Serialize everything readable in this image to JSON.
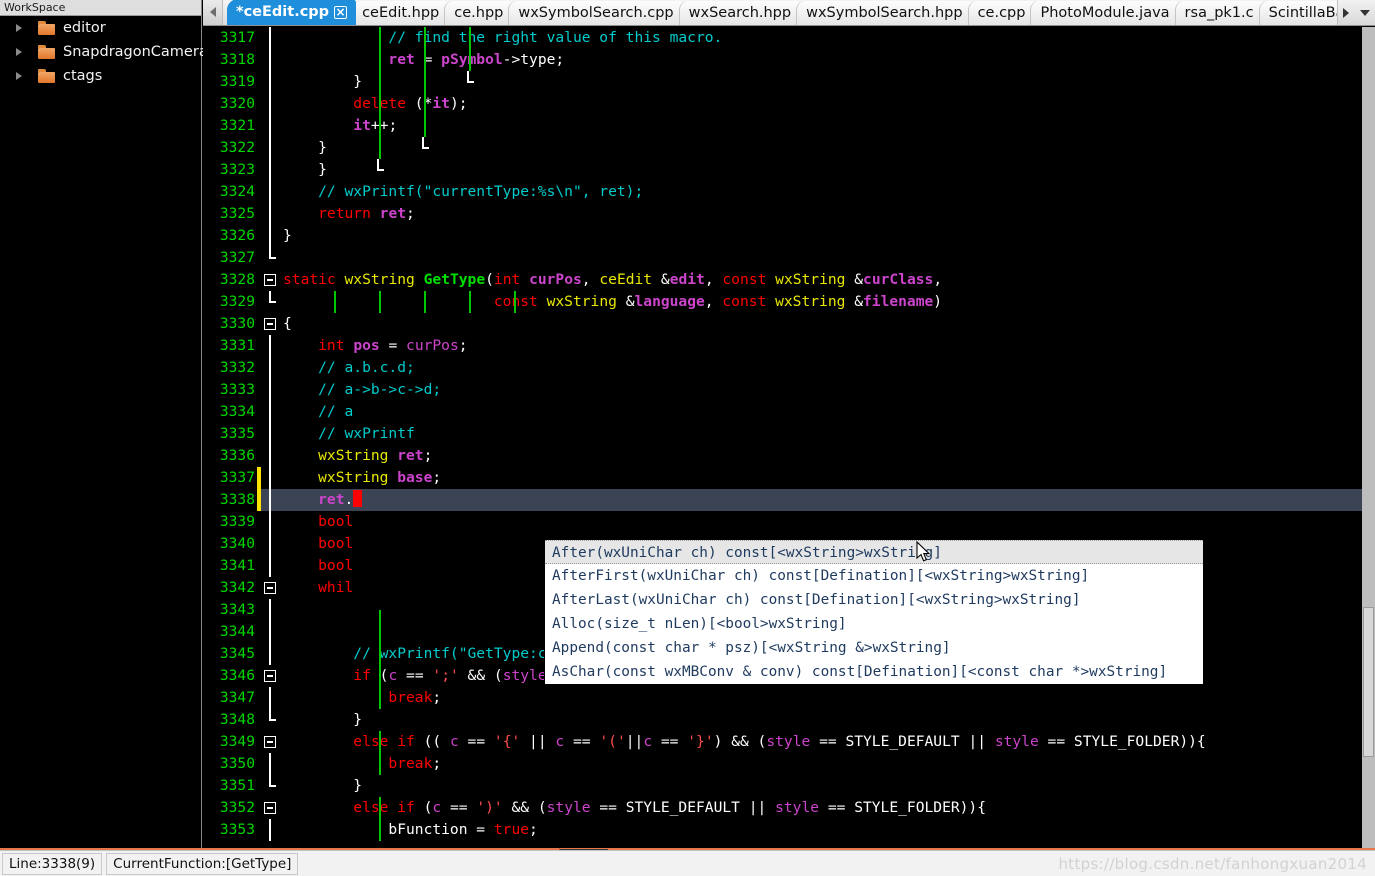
{
  "sidebar": {
    "header": "WorkSpace",
    "items": [
      {
        "label": "editor",
        "icon": "folder-icon",
        "expander": "triangle-right-icon"
      },
      {
        "label": "SnapdragonCamera",
        "icon": "folder-icon",
        "expander": "triangle-right-icon"
      },
      {
        "label": "ctags",
        "icon": "folder-icon",
        "expander": "triangle-right-icon"
      }
    ]
  },
  "tabbar": {
    "scroll_left_icon": "triangle-left-icon",
    "overflow_next_icon": "triangle-right-icon",
    "overflow_menu_icon": "chevron-down-icon",
    "close_glyph": "✖",
    "tabs": [
      {
        "label": "*ceEdit.cpp",
        "active": true,
        "closable": true
      },
      {
        "label": "ceEdit.hpp",
        "active": false,
        "closable": false
      },
      {
        "label": "ce.hpp",
        "active": false,
        "closable": false
      },
      {
        "label": "wxSymbolSearch.cpp",
        "active": false,
        "closable": false
      },
      {
        "label": "wxSearch.hpp",
        "active": false,
        "closable": false
      },
      {
        "label": "wxSymbolSearch.hpp",
        "active": false,
        "closable": false
      },
      {
        "label": "ce.cpp",
        "active": false,
        "closable": false
      },
      {
        "label": "PhotoModule.java",
        "active": false,
        "closable": false
      },
      {
        "label": "rsa_pk1.c",
        "active": false,
        "closable": false
      },
      {
        "label": "ScintillaBase.c",
        "active": false,
        "closable": false
      }
    ]
  },
  "editor": {
    "first_line": 3317,
    "current_line": 3338,
    "lines": [
      {
        "n": "3317",
        "text": "            // find the right value of this macro."
      },
      {
        "n": "3318",
        "text": "            ret = pSymbol->type;"
      },
      {
        "n": "3319",
        "text": "        }"
      },
      {
        "n": "3320",
        "text": "        delete (*it);"
      },
      {
        "n": "3321",
        "text": "        it++;"
      },
      {
        "n": "3322",
        "text": "    }"
      },
      {
        "n": "3323",
        "text": "}"
      },
      {
        "n": "3324",
        "text": "    // wxPrintf(\"currentType:%s\\n\", ret);"
      },
      {
        "n": "3325",
        "text": "    return ret;"
      },
      {
        "n": "3326",
        "text": "}"
      },
      {
        "n": "3327",
        "text": ""
      },
      {
        "n": "3328",
        "text": "static wxString GetType(int curPos, ceEdit &edit, const wxString &curClass,"
      },
      {
        "n": "3329",
        "text": "                        const wxString &language, const wxString &filename)"
      },
      {
        "n": "3330",
        "text": "{"
      },
      {
        "n": "3331",
        "text": "    int pos = curPos;"
      },
      {
        "n": "3332",
        "text": "    // a.b.c.d;"
      },
      {
        "n": "3333",
        "text": "    // a->b->c->d;"
      },
      {
        "n": "3334",
        "text": "    // a"
      },
      {
        "n": "3335",
        "text": "    // wxPrintf"
      },
      {
        "n": "3336",
        "text": "    wxString ret;"
      },
      {
        "n": "3337",
        "text": "    wxString base;"
      },
      {
        "n": "3338",
        "text": "    ret."
      },
      {
        "n": "3339",
        "text": "    bool"
      },
      {
        "n": "3340",
        "text": "    bool"
      },
      {
        "n": "3341",
        "text": "    bool"
      },
      {
        "n": "3342",
        "text": "    whil"
      },
      {
        "n": "3343",
        "text": ""
      },
      {
        "n": "3344",
        "text": ""
      },
      {
        "n": "3345",
        "text": "    // wxPrintf(\"GetType:c<%c>,style<%d>\\n\", c, style);"
      },
      {
        "n": "3346",
        "text": "        if (c == ';' && (style == STYLE_DEFAULT || style == STYLE_NORMAL)){"
      },
      {
        "n": "3347",
        "text": "            break;"
      },
      {
        "n": "3348",
        "text": "        }"
      },
      {
        "n": "3349",
        "text": "        else if (( c == '{' || c == '('||c == '}') && (style == STYLE_DEFAULT || style == STYLE_FOLDER)){"
      },
      {
        "n": "3350",
        "text": "            break;"
      },
      {
        "n": "3351",
        "text": "        }"
      },
      {
        "n": "3352",
        "text": "        else if (c == ')' && (style == STYLE_DEFAULT || style == STYLE_FOLDER)){"
      },
      {
        "n": "3353",
        "text": "            bFunction = true;"
      }
    ]
  },
  "autocomplete": {
    "selected_index": 0,
    "items": [
      "After(wxUniChar ch) const[<wxString>wxString]",
      "AfterFirst(wxUniChar ch) const[Defination][<wxString>wxString]",
      "AfterLast(wxUniChar ch) const[Defination][<wxString>wxString]",
      "Alloc(size_t nLen)[<bool>wxString]",
      "Append(const char * psz)[<wxString &>wxString]",
      "AsChar(const wxMBConv & conv) const[Defination][<const char *>wxString]"
    ]
  },
  "statusbar": {
    "line_info": "Line:3338(9)",
    "function_info": "CurrentFunction:[GetType]"
  },
  "watermark": "https://blog.csdn.net/fanhongxuan2014",
  "colors": {
    "editor_background": "#000000",
    "line_number": "#00d800",
    "comment": "#00cccc",
    "keyword": "#ff0000",
    "type": "#e8e800",
    "variable": "#cc44cc",
    "function": "#00e000",
    "string": "#ff4d4d",
    "current_line_highlight": "#3b4354",
    "caret": "#ff0000",
    "modified_marker": "#ffe100",
    "active_tab": "#1f8fdb",
    "indent_guide": "#00c800",
    "hscrollbar": "#e8764b",
    "folder_icon": "#e2762a"
  }
}
